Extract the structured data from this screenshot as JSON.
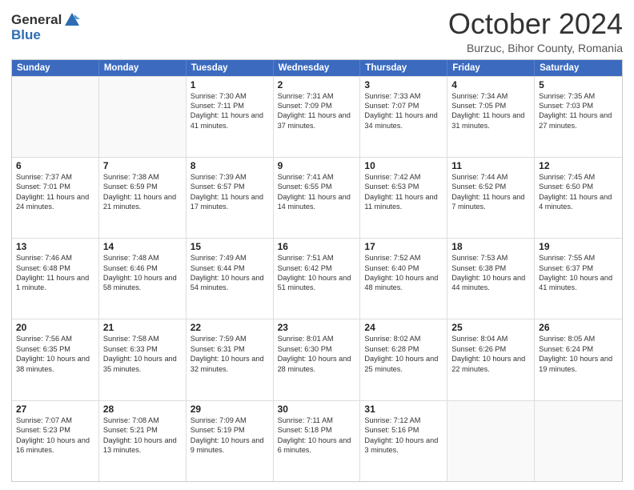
{
  "header": {
    "logo_line1": "General",
    "logo_line2": "Blue",
    "month": "October 2024",
    "location": "Burzuc, Bihor County, Romania"
  },
  "weekdays": [
    "Sunday",
    "Monday",
    "Tuesday",
    "Wednesday",
    "Thursday",
    "Friday",
    "Saturday"
  ],
  "weeks": [
    [
      {
        "day": "",
        "sunrise": "",
        "sunset": "",
        "daylight": ""
      },
      {
        "day": "",
        "sunrise": "",
        "sunset": "",
        "daylight": ""
      },
      {
        "day": "1",
        "sunrise": "Sunrise: 7:30 AM",
        "sunset": "Sunset: 7:11 PM",
        "daylight": "Daylight: 11 hours and 41 minutes."
      },
      {
        "day": "2",
        "sunrise": "Sunrise: 7:31 AM",
        "sunset": "Sunset: 7:09 PM",
        "daylight": "Daylight: 11 hours and 37 minutes."
      },
      {
        "day": "3",
        "sunrise": "Sunrise: 7:33 AM",
        "sunset": "Sunset: 7:07 PM",
        "daylight": "Daylight: 11 hours and 34 minutes."
      },
      {
        "day": "4",
        "sunrise": "Sunrise: 7:34 AM",
        "sunset": "Sunset: 7:05 PM",
        "daylight": "Daylight: 11 hours and 31 minutes."
      },
      {
        "day": "5",
        "sunrise": "Sunrise: 7:35 AM",
        "sunset": "Sunset: 7:03 PM",
        "daylight": "Daylight: 11 hours and 27 minutes."
      }
    ],
    [
      {
        "day": "6",
        "sunrise": "Sunrise: 7:37 AM",
        "sunset": "Sunset: 7:01 PM",
        "daylight": "Daylight: 11 hours and 24 minutes."
      },
      {
        "day": "7",
        "sunrise": "Sunrise: 7:38 AM",
        "sunset": "Sunset: 6:59 PM",
        "daylight": "Daylight: 11 hours and 21 minutes."
      },
      {
        "day": "8",
        "sunrise": "Sunrise: 7:39 AM",
        "sunset": "Sunset: 6:57 PM",
        "daylight": "Daylight: 11 hours and 17 minutes."
      },
      {
        "day": "9",
        "sunrise": "Sunrise: 7:41 AM",
        "sunset": "Sunset: 6:55 PM",
        "daylight": "Daylight: 11 hours and 14 minutes."
      },
      {
        "day": "10",
        "sunrise": "Sunrise: 7:42 AM",
        "sunset": "Sunset: 6:53 PM",
        "daylight": "Daylight: 11 hours and 11 minutes."
      },
      {
        "day": "11",
        "sunrise": "Sunrise: 7:44 AM",
        "sunset": "Sunset: 6:52 PM",
        "daylight": "Daylight: 11 hours and 7 minutes."
      },
      {
        "day": "12",
        "sunrise": "Sunrise: 7:45 AM",
        "sunset": "Sunset: 6:50 PM",
        "daylight": "Daylight: 11 hours and 4 minutes."
      }
    ],
    [
      {
        "day": "13",
        "sunrise": "Sunrise: 7:46 AM",
        "sunset": "Sunset: 6:48 PM",
        "daylight": "Daylight: 11 hours and 1 minute."
      },
      {
        "day": "14",
        "sunrise": "Sunrise: 7:48 AM",
        "sunset": "Sunset: 6:46 PM",
        "daylight": "Daylight: 10 hours and 58 minutes."
      },
      {
        "day": "15",
        "sunrise": "Sunrise: 7:49 AM",
        "sunset": "Sunset: 6:44 PM",
        "daylight": "Daylight: 10 hours and 54 minutes."
      },
      {
        "day": "16",
        "sunrise": "Sunrise: 7:51 AM",
        "sunset": "Sunset: 6:42 PM",
        "daylight": "Daylight: 10 hours and 51 minutes."
      },
      {
        "day": "17",
        "sunrise": "Sunrise: 7:52 AM",
        "sunset": "Sunset: 6:40 PM",
        "daylight": "Daylight: 10 hours and 48 minutes."
      },
      {
        "day": "18",
        "sunrise": "Sunrise: 7:53 AM",
        "sunset": "Sunset: 6:38 PM",
        "daylight": "Daylight: 10 hours and 44 minutes."
      },
      {
        "day": "19",
        "sunrise": "Sunrise: 7:55 AM",
        "sunset": "Sunset: 6:37 PM",
        "daylight": "Daylight: 10 hours and 41 minutes."
      }
    ],
    [
      {
        "day": "20",
        "sunrise": "Sunrise: 7:56 AM",
        "sunset": "Sunset: 6:35 PM",
        "daylight": "Daylight: 10 hours and 38 minutes."
      },
      {
        "day": "21",
        "sunrise": "Sunrise: 7:58 AM",
        "sunset": "Sunset: 6:33 PM",
        "daylight": "Daylight: 10 hours and 35 minutes."
      },
      {
        "day": "22",
        "sunrise": "Sunrise: 7:59 AM",
        "sunset": "Sunset: 6:31 PM",
        "daylight": "Daylight: 10 hours and 32 minutes."
      },
      {
        "day": "23",
        "sunrise": "Sunrise: 8:01 AM",
        "sunset": "Sunset: 6:30 PM",
        "daylight": "Daylight: 10 hours and 28 minutes."
      },
      {
        "day": "24",
        "sunrise": "Sunrise: 8:02 AM",
        "sunset": "Sunset: 6:28 PM",
        "daylight": "Daylight: 10 hours and 25 minutes."
      },
      {
        "day": "25",
        "sunrise": "Sunrise: 8:04 AM",
        "sunset": "Sunset: 6:26 PM",
        "daylight": "Daylight: 10 hours and 22 minutes."
      },
      {
        "day": "26",
        "sunrise": "Sunrise: 8:05 AM",
        "sunset": "Sunset: 6:24 PM",
        "daylight": "Daylight: 10 hours and 19 minutes."
      }
    ],
    [
      {
        "day": "27",
        "sunrise": "Sunrise: 7:07 AM",
        "sunset": "Sunset: 5:23 PM",
        "daylight": "Daylight: 10 hours and 16 minutes."
      },
      {
        "day": "28",
        "sunrise": "Sunrise: 7:08 AM",
        "sunset": "Sunset: 5:21 PM",
        "daylight": "Daylight: 10 hours and 13 minutes."
      },
      {
        "day": "29",
        "sunrise": "Sunrise: 7:09 AM",
        "sunset": "Sunset: 5:19 PM",
        "daylight": "Daylight: 10 hours and 9 minutes."
      },
      {
        "day": "30",
        "sunrise": "Sunrise: 7:11 AM",
        "sunset": "Sunset: 5:18 PM",
        "daylight": "Daylight: 10 hours and 6 minutes."
      },
      {
        "day": "31",
        "sunrise": "Sunrise: 7:12 AM",
        "sunset": "Sunset: 5:16 PM",
        "daylight": "Daylight: 10 hours and 3 minutes."
      },
      {
        "day": "",
        "sunrise": "",
        "sunset": "",
        "daylight": ""
      },
      {
        "day": "",
        "sunrise": "",
        "sunset": "",
        "daylight": ""
      }
    ]
  ]
}
